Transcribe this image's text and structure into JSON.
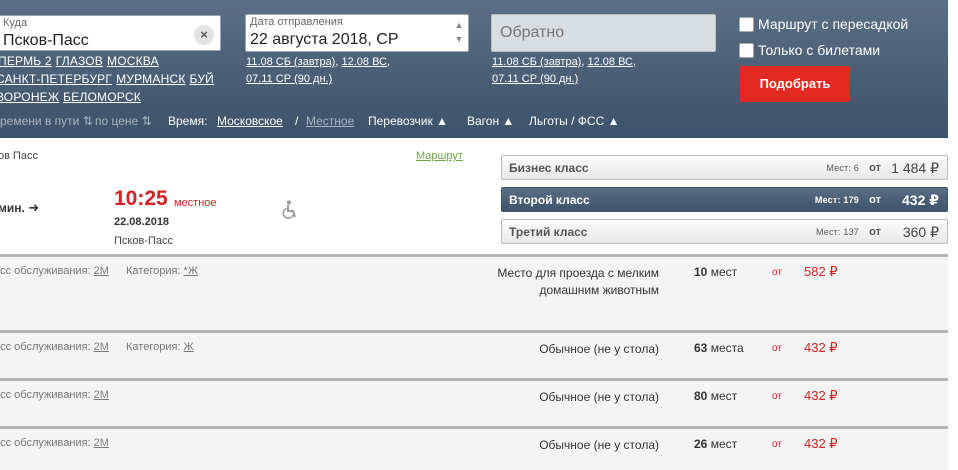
{
  "search": {
    "to_label": "Куда",
    "to_value": "Псков-Пасс",
    "clear_icon": "×",
    "date_label": "Дата отправления",
    "date_value": "22 августа 2018, СР",
    "return_value": "Обратно",
    "depart_quick_dates": [
      "11.08 СБ (завтра)",
      "12.08 ВС",
      "07.11 СР (90 дн.)"
    ],
    "return_quick_dates": [
      "11.08 СБ (завтра)",
      "12.08 ВС",
      "07.11 СР (90 дн.)"
    ],
    "transfer_label": "Маршрут с пересадкой",
    "tickets_only_label": "Только с билетами",
    "submit_label": "Подобрать"
  },
  "quick_cities": [
    "ПЕРМЬ 2",
    "ГЛАЗОВ",
    "МОСКВА",
    "САНКТ-ПЕТЕРБУРГ",
    "МУРМАНСК",
    "БУЙ",
    "ВОРОНЕЖ",
    "БЕЛОМОРСК"
  ],
  "sortbar": {
    "time_in_way": "Времени в пути",
    "by_price": "по цене",
    "time_label": "Время:",
    "moscow": "Московское",
    "slash": "/",
    "local": "Местное",
    "carrier": "Перевозчик",
    "wagon": "Вагон",
    "benefits": "Льготы / ФСС"
  },
  "train": {
    "origin_fragment": "ов Пасс",
    "route_link": "Маршрут",
    "duration_fragment": "мин.",
    "arrival_time": "10:25",
    "arrival_time_note": "местное",
    "arrival_date": "22.08.2018",
    "arrival_station": "Псков-Пасс"
  },
  "classes": [
    {
      "name": "Бизнес класс",
      "seats": "Мест: 6",
      "ot": "от",
      "price": "1 484 ₽",
      "active": false
    },
    {
      "name": "Второй класс",
      "seats": "Мест: 179",
      "ot": "от",
      "price": "432 ₽",
      "active": true
    },
    {
      "name": "Третий класс",
      "seats": "Мест: 137",
      "ot": "от",
      "price": "360 ₽",
      "active": false
    }
  ],
  "seat_rows": [
    {
      "service_label": "асс обслуживания:",
      "service_class": "2М",
      "category_label": "Категория:",
      "category": "*Ж",
      "kind_line1": "Место для проезда с мелким",
      "kind_line2": "домашним животным",
      "count": "10",
      "count_word": "мест",
      "ot": "от",
      "price": "582 ₽"
    },
    {
      "service_label": "асс обслуживания:",
      "service_class": "2М",
      "category_label": "Категория:",
      "category": "Ж",
      "kind_line1": "Обычное (не у стола)",
      "kind_line2": "",
      "count": "63",
      "count_word": "места",
      "ot": "от",
      "price": "432 ₽"
    },
    {
      "service_label": "асс обслуживания:",
      "service_class": "2М",
      "category_label": "",
      "category": "",
      "kind_line1": "Обычное (не у стола)",
      "kind_line2": "",
      "count": "80",
      "count_word": "мест",
      "ot": "от",
      "price": "432 ₽"
    },
    {
      "service_label": "асс обслуживания:",
      "service_class": "2М",
      "category_label": "",
      "category": "",
      "kind_line1": "Обычное (не у стола)",
      "kind_line2": "",
      "count": "26",
      "count_word": "мест",
      "ot": "от",
      "price": "432 ₽"
    }
  ],
  "colors": {
    "header": "#4a6078",
    "accent_red": "#e32a22",
    "price_red": "#d32222",
    "link_green": "#6aa842"
  }
}
